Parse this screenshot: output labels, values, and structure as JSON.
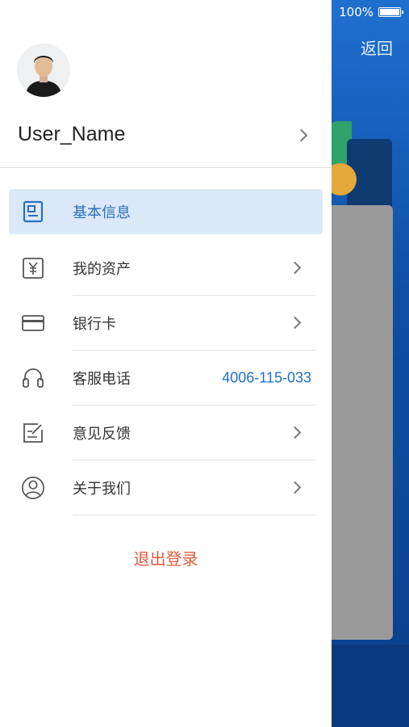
{
  "status_bar": {
    "battery_text": "100%"
  },
  "background_app": {
    "back_label": "返回"
  },
  "drawer": {
    "username": "User_Name",
    "menu": [
      {
        "id": "basic-info",
        "label": "基本信息",
        "icon": "id-card-icon",
        "active": true
      },
      {
        "id": "my-assets",
        "label": "我的资产",
        "icon": "yen-icon"
      },
      {
        "id": "bank-card",
        "label": "银行卡",
        "icon": "credit-card-icon"
      },
      {
        "id": "customer-service",
        "label": "客服电话",
        "icon": "headset-icon",
        "value": "4006-115-033"
      },
      {
        "id": "feedback",
        "label": "意见反馈",
        "icon": "edit-note-icon"
      },
      {
        "id": "about-us",
        "label": "关于我们",
        "icon": "user-circle-icon"
      }
    ],
    "logout_label": "退出登录"
  },
  "colors": {
    "accent": "#1f6fcf",
    "active_bg": "#dbe8f8",
    "logout": "#e05a3c"
  }
}
